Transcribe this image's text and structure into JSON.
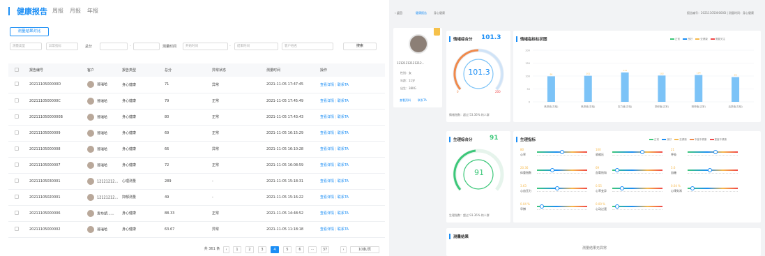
{
  "left": {
    "title": "健康报告",
    "tabs": [
      "周报",
      "月报",
      "年报"
    ],
    "compare_button": "测量结果对比",
    "filters": {
      "select1": "测量类型",
      "select2": "异常指标",
      "score_label": "总分",
      "time_label": "测量时间",
      "start_placeholder": "开始时间",
      "end_placeholder": "结束时间",
      "customer_placeholder": "客户姓名",
      "search_button": "搜索"
    },
    "columns": [
      "报告编号",
      "客户",
      "报告类型",
      "总分",
      "异常状态",
      "测量时间",
      "操作"
    ],
    "rows": [
      {
        "id": "2021110500000D",
        "customer": "普瑞哈",
        "type": "身心健康",
        "score": "71",
        "status": "异常",
        "time": "2021-11-05 17:47:45"
      },
      {
        "id": "2021110500000C",
        "customer": "普瑞哈",
        "type": "身心健康",
        "score": "79",
        "status": "正常",
        "time": "2021-11-05 17:45:49"
      },
      {
        "id": "20211105000000B",
        "customer": "普瑞哈",
        "type": "身心健康",
        "score": "80",
        "status": "正常",
        "time": "2021-11-05 17:43:43"
      },
      {
        "id": "20211105000009",
        "customer": "普瑞哈",
        "type": "身心健康",
        "score": "69",
        "status": "正常",
        "time": "2021-11-05 16:15:29"
      },
      {
        "id": "20211105000008",
        "customer": "普瑞哈",
        "type": "身心健康",
        "score": "66",
        "status": "异常",
        "time": "2021-11-05 16:10:28"
      },
      {
        "id": "20211105000007",
        "customer": "普瑞哈",
        "type": "身心健康",
        "score": "72",
        "status": "正常",
        "time": "2021-11-05 16:08:59"
      },
      {
        "id": "20211105030001",
        "customer": "12121212...",
        "type": "心理测量",
        "score": "289",
        "status": "-",
        "time": "2021-11-05 15:18:31"
      },
      {
        "id": "20211105020001",
        "customer": "12121212...",
        "type": "抑郁测量",
        "score": "49",
        "status": "-",
        "time": "2021-11-05 15:16:22"
      },
      {
        "id": "20211105000006",
        "customer": "发布胡......",
        "type": "身心健康",
        "score": "88.33",
        "status": "正常",
        "time": "2021-11-05 14:48:52"
      },
      {
        "id": "20211105000002",
        "customer": "普瑞哈",
        "type": "身心健康",
        "score": "63.67",
        "status": "异常",
        "time": "2021-11-05 11:18:18"
      }
    ],
    "action_view": "查看详情",
    "action_contact": "联系TA",
    "pagination": {
      "total": "共 361 条",
      "pages": [
        "1",
        "2",
        "3",
        "4",
        "5",
        "6",
        "···",
        "37"
      ],
      "current": "4",
      "prev": "‹",
      "next": "›",
      "per_page": "10条/页"
    }
  },
  "right": {
    "breadcrumb": [
      "‹ 返回",
      "健康报告",
      "身心健康"
    ],
    "report_meta": "报告编号：2021110500000D | 测量时间：身心健康",
    "profile": {
      "name": "12121212121212...",
      "gender_label": "性别：",
      "gender": "女",
      "age_label": "年龄：",
      "age": "11岁",
      "height_label": "出生：",
      "height": "38KG",
      "link1": "查看资料",
      "link2": "联系TA"
    },
    "mental_card": {
      "title": "情绪综合分",
      "score": "101.3",
      "unit": "分",
      "footer": "情绪指数：超过 53.36% 的人群",
      "gauge_min": "0",
      "gauge_max": "200"
    },
    "emotion_chart": {
      "title": "情绪指标柱状图",
      "legend": [
        "正常",
        "良好",
        "亚健康",
        "需要关注"
      ]
    },
    "physical_card": {
      "title": "生理综合分",
      "score": "91",
      "unit": "分",
      "footer": "生理指数：超过 93.36% 的人群"
    },
    "physio_panel": {
      "title": "生理指标",
      "legend": [
        "正常",
        "良好",
        "亚健康",
        "中度不健康",
        "重度不健康"
      ]
    },
    "result": {
      "title": "测量结果",
      "text": "测量结果无异常"
    },
    "colors": {
      "accent": "#1b8ef5",
      "bar": "#7cc3f7",
      "good": "#3cc779",
      "warn": "#f6b84a",
      "bad": "#f04848"
    }
  },
  "chart_data": {
    "type": "bar",
    "title": "情绪指标柱状图",
    "categories": [
      "焦虑值(左轴)",
      "焦虑值(右轴)",
      "压力值(左轴)",
      "抑郁值(正常)",
      "精神值(正常)",
      "活跃值(左轴)"
    ],
    "values": [
      99,
      101,
      114,
      102,
      104,
      96
    ],
    "ylim": [
      0,
      200
    ],
    "yticks": [
      "200",
      "150",
      "100",
      "50",
      "0"
    ],
    "grid": true,
    "legend_placement": "top-right"
  },
  "physio_metrics": [
    {
      "value": "80",
      "label": "心率",
      "pos": 0.5
    },
    {
      "value": "100",
      "label": "收缩压",
      "pos": 0.6
    },
    {
      "value": "21",
      "label": "呼吸",
      "pos": 0.55
    },
    {
      "value": "20.36",
      "label": "体重指数",
      "pos": 0.3
    },
    {
      "value": "69",
      "label": "血氧饱和",
      "pos": 0.1
    },
    {
      "value": "5.6",
      "label": "血糖",
      "pos": 0.45
    },
    {
      "value": "3.63",
      "label": "心血压力",
      "pos": 0.4
    },
    {
      "value": "0.55",
      "label": "心率变异",
      "pos": 0.2
    },
    {
      "value": "0.04 %",
      "label": "心律失常",
      "pos": 0.1
    },
    {
      "value": "0.04 %",
      "label": "早搏",
      "pos": 0.1
    },
    {
      "value": "0.00 %",
      "label": "心动过速",
      "pos": 0.1
    }
  ]
}
